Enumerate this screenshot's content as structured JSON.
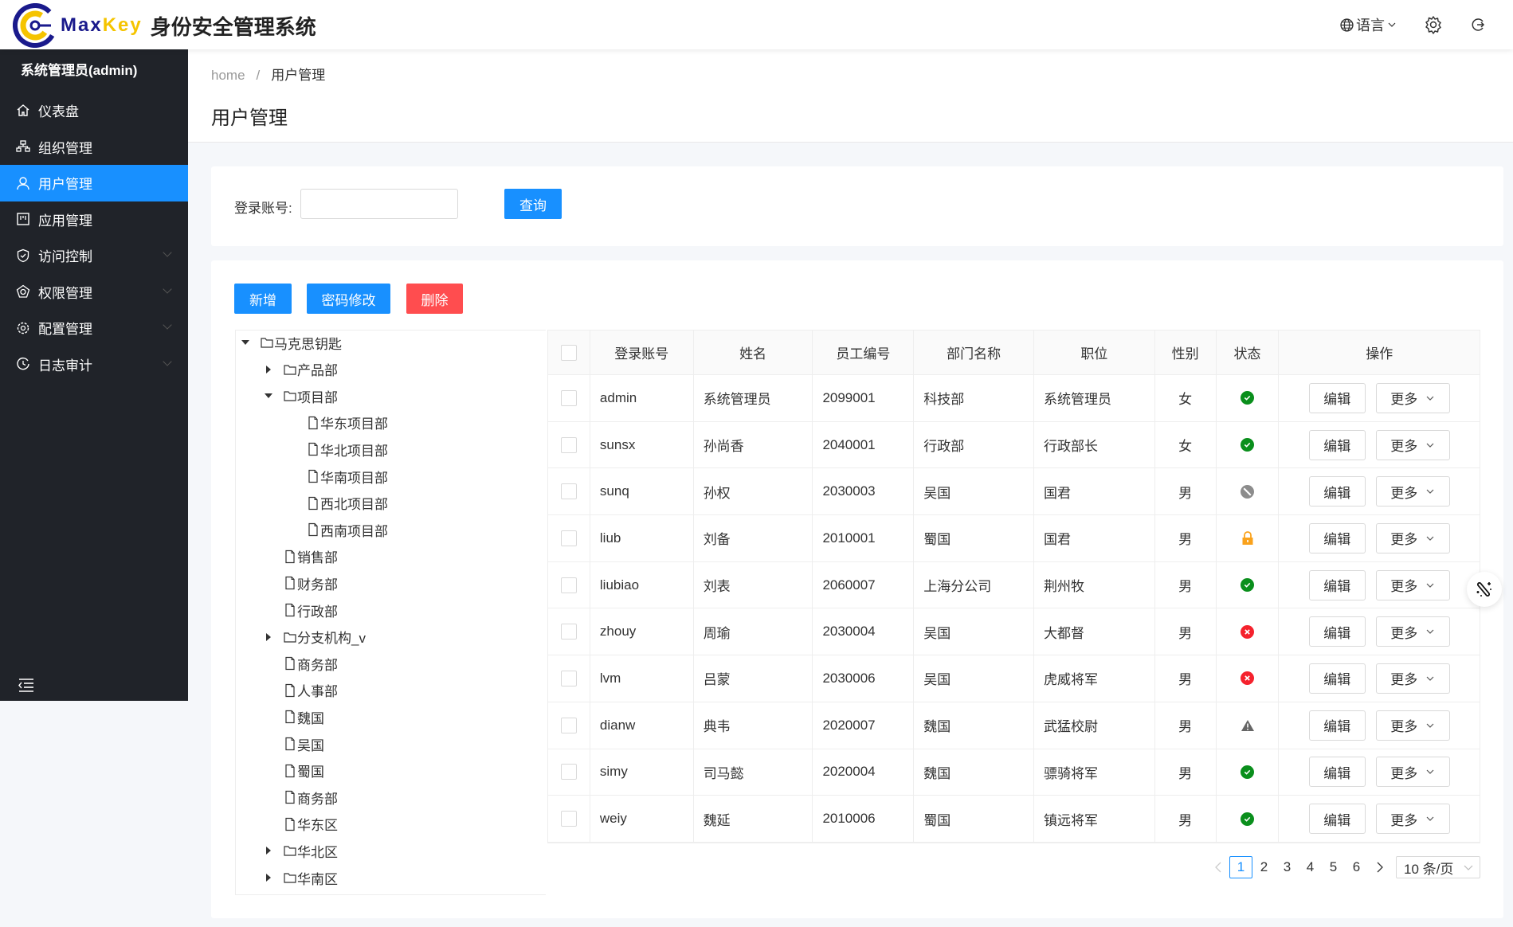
{
  "header": {
    "logo_text_a": "Max",
    "logo_text_b": "Key",
    "system_name": "身份安全管理系统",
    "language": "语言",
    "icons": [
      "globe-icon",
      "gear-icon",
      "logout-icon"
    ]
  },
  "sidebar": {
    "user": "系统管理员(admin)",
    "items": [
      {
        "label": "仪表盘",
        "icon": "home-icon",
        "expandable": false,
        "active": false
      },
      {
        "label": "组织管理",
        "icon": "org-icon",
        "expandable": false,
        "active": false
      },
      {
        "label": "用户管理",
        "icon": "user-icon",
        "expandable": false,
        "active": true
      },
      {
        "label": "应用管理",
        "icon": "app-icon",
        "expandable": false,
        "active": false
      },
      {
        "label": "访问控制",
        "icon": "shield-icon",
        "expandable": true,
        "active": false
      },
      {
        "label": "权限管理",
        "icon": "permission-icon",
        "expandable": true,
        "active": false
      },
      {
        "label": "配置管理",
        "icon": "settings-icon",
        "expandable": true,
        "active": false
      },
      {
        "label": "日志审计",
        "icon": "clock-icon",
        "expandable": true,
        "active": false
      }
    ]
  },
  "breadcrumb": {
    "home": "home",
    "separator": "/",
    "current": "用户管理"
  },
  "page_title": "用户管理",
  "search": {
    "label": "登录账号:",
    "value": "",
    "query_button": "查询"
  },
  "toolbar": {
    "add": "新增",
    "change_password": "密码修改",
    "delete": "删除"
  },
  "colors": {
    "primary": "#1890ff",
    "danger": "#ff4d4f",
    "sidebar_bg": "#202329",
    "ok": "#0a8f1c",
    "warn": "#faa21b",
    "error": "#f5222d",
    "disabled": "#8c8c8c"
  },
  "tree": [
    {
      "label": "马克思钥匙",
      "level": 0,
      "type": "folder",
      "state": "expanded"
    },
    {
      "label": "产品部",
      "level": 1,
      "type": "folder",
      "state": "collapsed"
    },
    {
      "label": "项目部",
      "level": 1,
      "type": "folder",
      "state": "expanded"
    },
    {
      "label": "华东项目部",
      "level": 2,
      "type": "file"
    },
    {
      "label": "华北项目部",
      "level": 2,
      "type": "file"
    },
    {
      "label": "华南项目部",
      "level": 2,
      "type": "file"
    },
    {
      "label": "西北项目部",
      "level": 2,
      "type": "file"
    },
    {
      "label": "西南项目部",
      "level": 2,
      "type": "file"
    },
    {
      "label": "销售部",
      "level": 1,
      "type": "file"
    },
    {
      "label": "财务部",
      "level": 1,
      "type": "file"
    },
    {
      "label": "行政部",
      "level": 1,
      "type": "file"
    },
    {
      "label": "分支机构_v",
      "level": 1,
      "type": "folder",
      "state": "collapsed"
    },
    {
      "label": "商务部",
      "level": 1,
      "type": "file"
    },
    {
      "label": "人事部",
      "level": 1,
      "type": "file"
    },
    {
      "label": "魏国",
      "level": 1,
      "type": "file"
    },
    {
      "label": "吴国",
      "level": 1,
      "type": "file"
    },
    {
      "label": "蜀国",
      "level": 1,
      "type": "file"
    },
    {
      "label": "商务部",
      "level": 1,
      "type": "file"
    },
    {
      "label": "华东区",
      "level": 1,
      "type": "file"
    },
    {
      "label": "华北区",
      "level": 1,
      "type": "folder",
      "state": "collapsed"
    },
    {
      "label": "华南区",
      "level": 1,
      "type": "folder",
      "state": "collapsed"
    }
  ],
  "table": {
    "columns": [
      "登录账号",
      "姓名",
      "员工编号",
      "部门名称",
      "职位",
      "性别",
      "状态",
      "操作"
    ],
    "edit_label": "编辑",
    "more_label": "更多",
    "rows": [
      {
        "username": "admin",
        "name": "系统管理员",
        "employee_no": "2099001",
        "department": "科技部",
        "position": "系统管理员",
        "gender": "女",
        "status": "active"
      },
      {
        "username": "sunsx",
        "name": "孙尚香",
        "employee_no": "2040001",
        "department": "行政部",
        "position": "行政部长",
        "gender": "女",
        "status": "active"
      },
      {
        "username": "sunq",
        "name": "孙权",
        "employee_no": "2030003",
        "department": "吴国",
        "position": "国君",
        "gender": "男",
        "status": "disabled"
      },
      {
        "username": "liub",
        "name": "刘备",
        "employee_no": "2010001",
        "department": "蜀国",
        "position": "国君",
        "gender": "男",
        "status": "locked"
      },
      {
        "username": "liubiao",
        "name": "刘表",
        "employee_no": "2060007",
        "department": "上海分公司",
        "position": "荆州牧",
        "gender": "男",
        "status": "active"
      },
      {
        "username": "zhouy",
        "name": "周瑜",
        "employee_no": "2030004",
        "department": "吴国",
        "position": "大都督",
        "gender": "男",
        "status": "error"
      },
      {
        "username": "lvm",
        "name": "吕蒙",
        "employee_no": "2030006",
        "department": "吴国",
        "position": "虎威将军",
        "gender": "男",
        "status": "error"
      },
      {
        "username": "dianw",
        "name": "典韦",
        "employee_no": "2020007",
        "department": "魏国",
        "position": "武猛校尉",
        "gender": "男",
        "status": "warning"
      },
      {
        "username": "simy",
        "name": "司马懿",
        "employee_no": "2020004",
        "department": "魏国",
        "position": "骠骑将军",
        "gender": "男",
        "status": "active"
      },
      {
        "username": "weiy",
        "name": "魏延",
        "employee_no": "2010006",
        "department": "蜀国",
        "position": "镇远将军",
        "gender": "男",
        "status": "active"
      }
    ]
  },
  "pagination": {
    "pages": [
      "1",
      "2",
      "3",
      "4",
      "5",
      "6"
    ],
    "current": "1",
    "page_size": "10 条/页"
  }
}
